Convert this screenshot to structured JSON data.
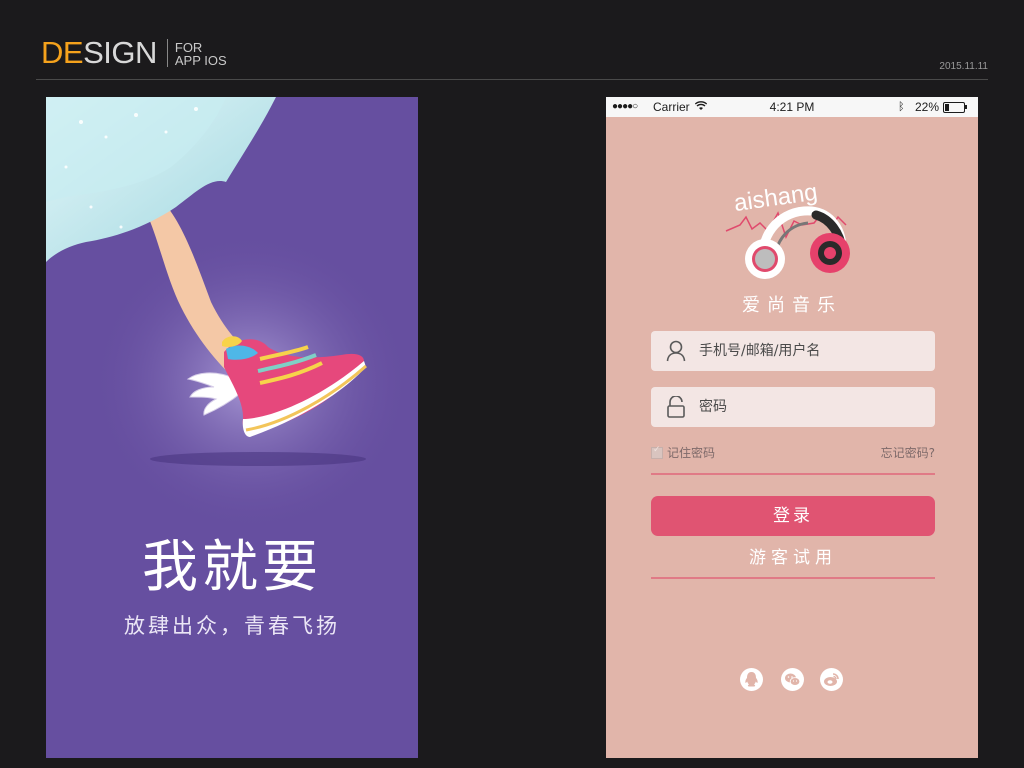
{
  "header": {
    "brand_de": "DE",
    "brand_sign": "SIGN",
    "brand_for": "FOR",
    "brand_app": "APP IOS",
    "date": "2015.11.11"
  },
  "splash": {
    "title": "我就要",
    "subtitle": "放肆出众，青春飞扬",
    "background_color": "#664fa0"
  },
  "login": {
    "status_bar": {
      "signal": "●●●●○",
      "carrier": "Carrier",
      "time": "4:21 PM",
      "battery": "22%",
      "battery_level": 0.22
    },
    "logo_text": "aishang",
    "app_name": "爱尚音乐",
    "username_placeholder": "手机号/邮箱/用户名",
    "password_placeholder": "密码",
    "remember_label": "记住密码",
    "remember_checked": true,
    "forgot_label": "忘记密码?",
    "login_button": "登录",
    "guest_button": "游客试用",
    "social_icons": [
      "qq-icon",
      "wechat-icon",
      "weibo-icon"
    ],
    "colors": {
      "background": "#e1b5aa",
      "accent": "#e05472",
      "field": "#f3e6e4"
    }
  }
}
